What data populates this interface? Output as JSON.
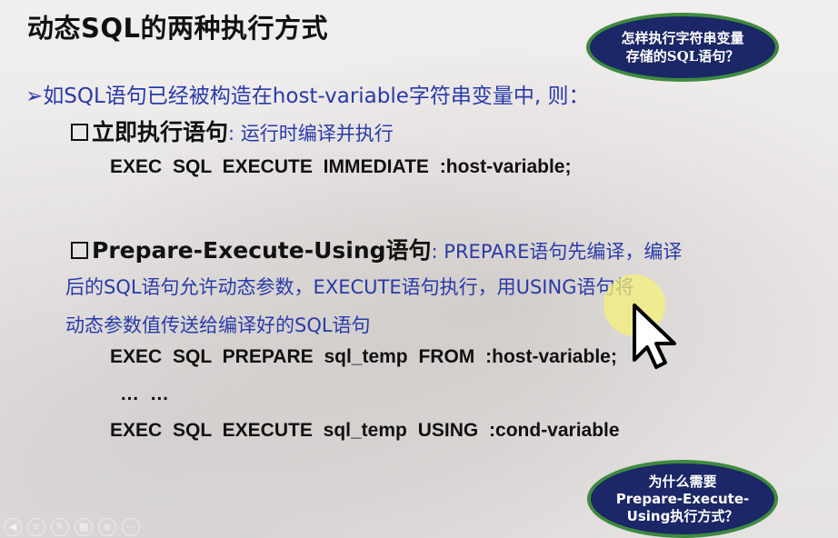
{
  "slide": {
    "title": "动态SQL的两种执行方式",
    "callout_top": {
      "line1": "怎样执行字符串变量",
      "line2": "存储的SQL语句？"
    },
    "bullet": "➢如SQL语句已经被构造在host-variable字符串变量中, 则：",
    "item1": {
      "heading": "立即执行语句",
      "desc": ": 运行时编译并执行",
      "code": "EXEC SQL EXECUTE IMMEDIATE :host-variable;"
    },
    "item2": {
      "heading": "Prepare-Execute-Using语句",
      "desc": ": PREPARE语句先编译，编译",
      "desc_line2": "后的SQL语句允许动态参数，EXECUTE语句执行，用USING语句将",
      "desc_line3": "动态参数值传送给编译好的SQL语句",
      "code1": "EXEC SQL PREPARE sql_temp FROM :host-variable;",
      "ellipsis": "… …",
      "code2": "EXEC SQL EXECUTE sql_temp USING :cond-variable"
    },
    "callout_bottom": {
      "line1": "为什么需要",
      "line2": "Prepare-Execute-",
      "line3": "Using执行方式？"
    }
  },
  "colors": {
    "accent_text": "#2a3aa8",
    "oval_fill": "#1b2766",
    "oval_border": "#3f8a3f",
    "pointer_highlight": "#f6f07a"
  },
  "icons": [
    "mouse-pointer-icon",
    "highlight-circle-icon",
    "presentation-control-icons"
  ]
}
